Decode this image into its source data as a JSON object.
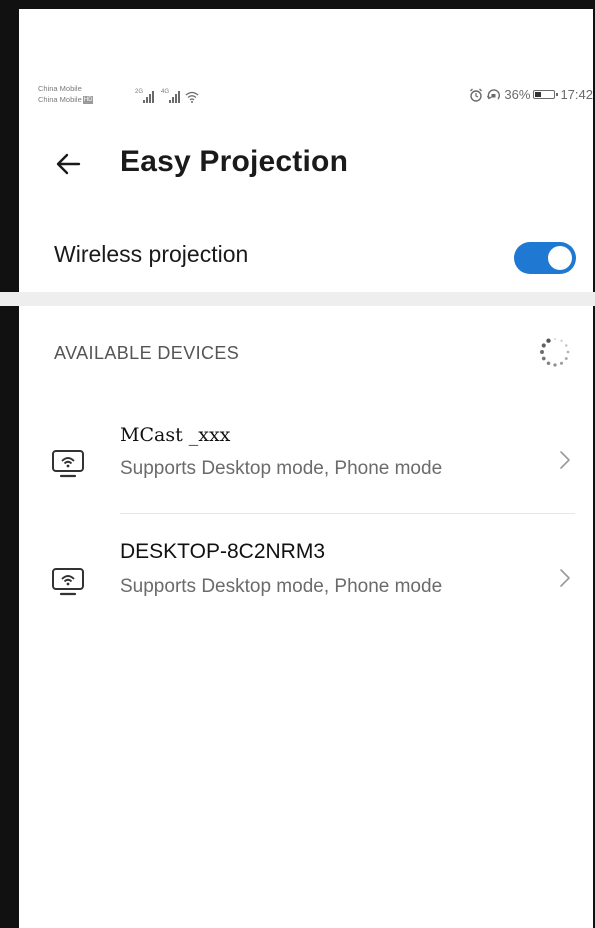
{
  "status_bar": {
    "carrier_1": "China Mobile",
    "carrier_2": "China Mobile",
    "network_badge": "HD",
    "sim1_tag": "2G",
    "sim2_tag": "4G",
    "battery_percent_text": "36%",
    "battery_level": 0.36,
    "time": "17:42",
    "icons": [
      "signal-icon",
      "signal-icon",
      "wifi-icon",
      "alarm-icon",
      "rotation-lock-icon",
      "battery-icon"
    ]
  },
  "header": {
    "title": "Easy Projection",
    "back_icon": "arrow-left-icon"
  },
  "wireless": {
    "label": "Wireless projection",
    "enabled": true
  },
  "devices_section": {
    "header": "AVAILABLE DEVICES",
    "loading_icon": "spinner-icon"
  },
  "devices": [
    {
      "name": "MCast _xxx",
      "subtitle": "Supports Desktop mode, Phone mode",
      "icon": "wifi-display-icon"
    },
    {
      "name": "DESKTOP-8C2NRM3",
      "subtitle": "Supports Desktop mode, Phone mode",
      "icon": "wifi-display-icon"
    }
  ],
  "colors": {
    "accent": "#1f78d1",
    "text_primary": "#1a1a1a",
    "text_secondary": "#6b6b6b",
    "divider_band": "#eeeeee"
  }
}
